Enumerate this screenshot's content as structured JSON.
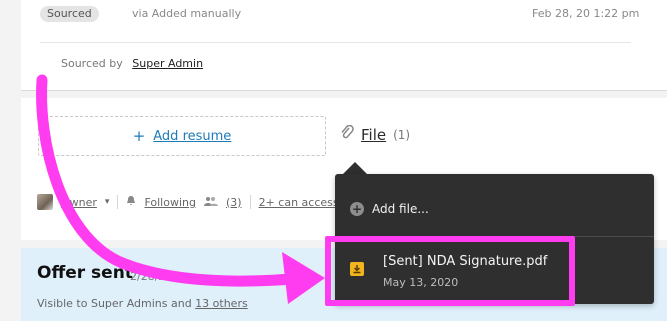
{
  "activity": {
    "status_badge": "Sourced",
    "source_text": "via Added manually",
    "timestamp": "Feb 28, 20 1:22 pm",
    "sourced_by_label": "Sourced by",
    "sourced_by_user": "Super Admin"
  },
  "attachments": {
    "add_resume_label": "Add resume",
    "file_tab_label": "File",
    "file_tab_count": "(1)"
  },
  "followers_bar": {
    "owner_label": "Owner",
    "following_label": "Following",
    "followers_count": "(3)",
    "access_label": "2+ can access"
  },
  "offer": {
    "title": "Offer sent",
    "date": "2/28/20",
    "visible_prefix": "Visible to Super Admins and",
    "visible_link": "13 others"
  },
  "file_menu": {
    "add_file_label": "Add file...",
    "files": [
      {
        "name": "[Sent] NDA Signature.pdf",
        "date": "May 13, 2020"
      }
    ]
  },
  "colors": {
    "accent_link": "#1e7ab8",
    "menu_bg": "#2f2f2f",
    "highlight": "#ff3cf0",
    "offer_bg": "#dff0fb"
  }
}
